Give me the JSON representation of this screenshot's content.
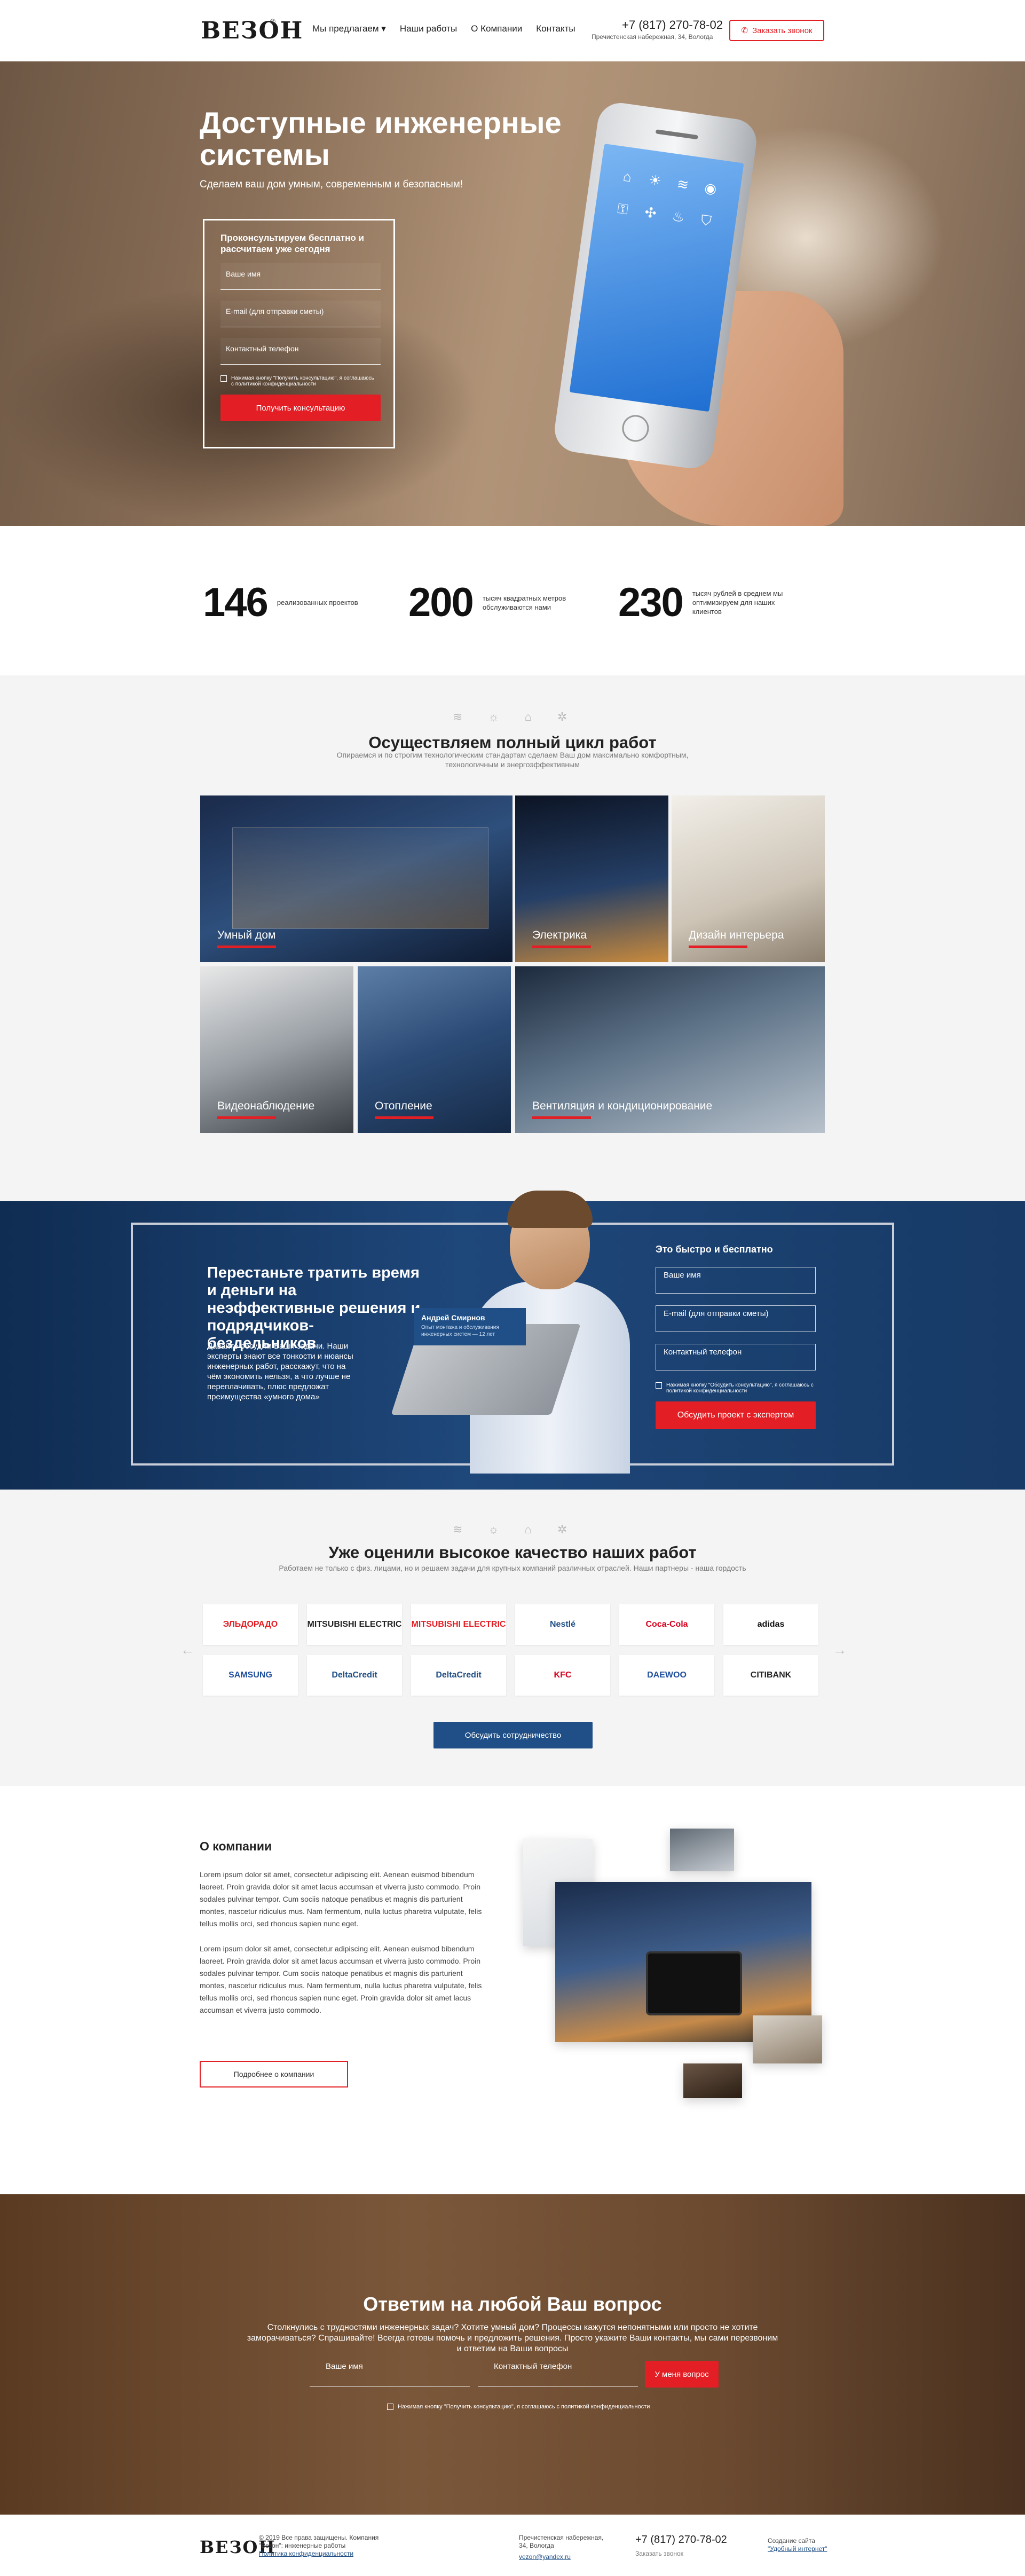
{
  "header": {
    "logo": "ВЕЗОН",
    "logo_reg": "®",
    "nav": [
      "Мы предлагаем",
      "Наши работы",
      "О Компании",
      "Контакты"
    ],
    "phone": "+7 (817) 270-78-02",
    "address": "Пречистенская набережная, 34, Вологда",
    "call_button": "Заказать звонок"
  },
  "hero": {
    "title": "Доступные инженерные системы",
    "subtitle": "Сделаем ваш дом умным, современным и безопасным!",
    "form_title": "Проконсультируем бесплатно и рассчитаем уже сегодня",
    "fields": [
      "Ваше имя",
      "E-mail (для отправки сметы)",
      "Контактный телефон"
    ],
    "agree": "Нажимая кнопку \"Получить консультацию\", я соглашаюсь с политикой конфиденциальности",
    "button": "Получить консультацию"
  },
  "stats": [
    {
      "number": "146",
      "text": "реализованных проектов"
    },
    {
      "number": "200",
      "text": "тысяч квадратных метров обслуживаются нами"
    },
    {
      "number": "230",
      "text": "тысяч рублей в среднем мы оптимизируем для наших клиентов"
    }
  ],
  "services": {
    "title": "Осуществляем полный цикл работ",
    "subtitle": "Опираемся и по строгим технологическим стандартам сделаем Ваш дом максимально комфортным, технологичным и энергоэффективным",
    "tiles": [
      "Умный дом",
      "Электрика",
      "Дизайн интерьера",
      "Видеонаблюдение",
      "Отопление",
      "Вентиляция и кондиционирование"
    ]
  },
  "expert": {
    "title": "Перестаньте тратить время и деньги на неэффективные решения и подрядчиков-бездельников",
    "text": "Давайте обсудим Ваши задачи. Наши эксперты знают все тонкости и нюансы инженерных работ, расскажут, что на чём экономить нельзя, а что лучше не переплачивать, плюс предложат преимущества «умного дома»",
    "person_name": "Андрей Смирнов",
    "person_role": "Опыт монтажа и обслуживания инженерных систем — 12 лет",
    "form_title": "Это быстро и бесплатно",
    "fields": [
      "Ваше имя",
      "E-mail (для отправки сметы)",
      "Контактный телефон"
    ],
    "agree": "Нажимая кнопку \"Обсудить консультацию\", я соглашаюсь с политикой конфиденциальности",
    "button": "Обсудить проект с экспертом"
  },
  "partners": {
    "title": "Уже оценили высокое качество наших работ",
    "subtitle": "Работаем не только с физ. лицами, но и решаем задачи для крупных компаний различных отраслей. Наши партнеры - наша гордость",
    "logos": [
      "ЭЛЬДОРАДО",
      "MITSUBISHI ELECTRIC",
      "MITSUBISHI ELECTRIC",
      "Nestlé",
      "Coca-Cola",
      "adidas",
      "SAMSUNG",
      "DeltaCredit",
      "DeltaCredit",
      "KFC",
      "DAEWOO",
      "CITIBANK"
    ],
    "logo_colors": [
      "#e31e24",
      "#222222",
      "#e31e24",
      "#1f4f86",
      "#d6001c",
      "#111111",
      "#1f4f9e",
      "#1f4f86",
      "#1f4f86",
      "#d6001c",
      "#1f4f9e",
      "#222222"
    ],
    "arrow_left": "←",
    "arrow_right": "→",
    "button": "Обсудить сотрудничество"
  },
  "about": {
    "title": "О компании",
    "paragraph1": "Lorem ipsum dolor sit amet, consectetur adipiscing elit. Aenean euismod bibendum laoreet. Proin gravida dolor sit amet lacus accumsan et viverra justo commodo. Proin sodales pulvinar tempor. Cum sociis natoque penatibus et magnis dis parturient montes, nascetur ridiculus mus. Nam fermentum, nulla luctus pharetra vulputate, felis tellus mollis orci, sed rhoncus sapien nunc eget.",
    "paragraph2": "Lorem ipsum dolor sit amet, consectetur adipiscing elit. Aenean euismod bibendum laoreet. Proin gravida dolor sit amet lacus accumsan et viverra justo commodo. Proin sodales pulvinar tempor. Cum sociis natoque penatibus et magnis dis parturient montes, nascetur ridiculus mus. Nam fermentum, nulla luctus pharetra vulputate, felis tellus mollis orci, sed rhoncus sapien nunc eget. Proin gravida dolor sit amet lacus accumsan et viverra justo commodo.",
    "button": "Подробнее о компании"
  },
  "question": {
    "title": "Ответим на любой Ваш вопрос",
    "subtitle": "Столкнулись с трудностями инженерных задач? Хотите умный дом? Процессы кажутся непонятными или просто не хотите заморачиваться? Спрашивайте! Всегда готовы помочь и предложить решения. Просто укажите Ваши контакты, мы сами перезвоним и ответим на Ваши вопросы",
    "fields": [
      "Ваше имя",
      "Контактный телефон"
    ],
    "button": "У меня вопрос",
    "agree": "Нажимая кнопку \"Получить консультацию\", я соглашаюсь с политикой конфиденциальности"
  },
  "footer": {
    "logo": "ВЕЗОН",
    "copyright": "© 2019 Все права защищены. Компания \"Везон\": инженерные работы",
    "privacy": "Политика конфиденциальности",
    "address": "Пречистенская набережная, 34, Вологда",
    "email": "vezon@yandex.ru",
    "phone": "+7 (817) 270-78-02",
    "call": "Заказать звонок",
    "dev_label": "Создание сайта",
    "dev_name": "\"Удобный интернет\""
  }
}
